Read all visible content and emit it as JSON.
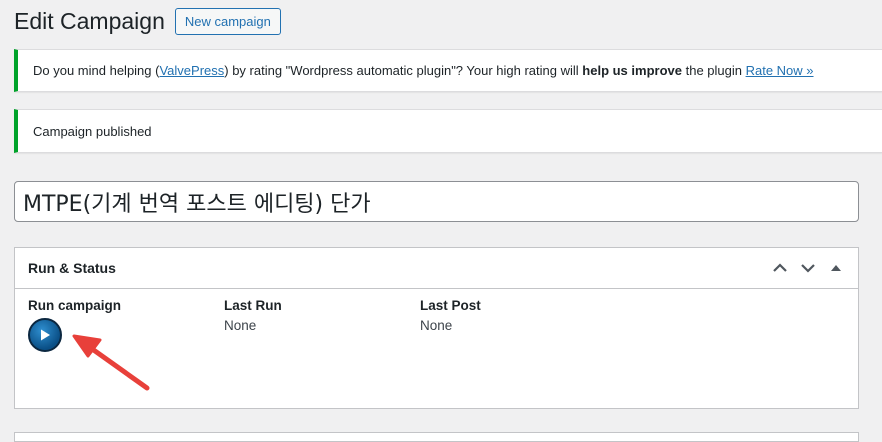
{
  "header": {
    "title": "Edit Campaign",
    "new_button": "New campaign"
  },
  "notices": {
    "rating": {
      "prefix": "Do you mind helping (",
      "link": "ValvePress",
      "middle": ") by rating \"Wordpress automatic plugin\"? Your high rating will ",
      "bold": "help us improve",
      "suffix": " the plugin ",
      "rate_link": "Rate Now »"
    },
    "published": "Campaign published"
  },
  "post_title": "MTPE(기계 번역 포스트 에디팅) 단가",
  "run_status": {
    "title": "Run & Status",
    "run_label": "Run campaign",
    "last_run_label": "Last Run",
    "last_run_value": "None",
    "last_post_label": "Last Post",
    "last_post_value": "None"
  },
  "colors": {
    "accent": "#2271b1",
    "success": "#00a32a",
    "annotation_arrow": "#e8403a"
  }
}
